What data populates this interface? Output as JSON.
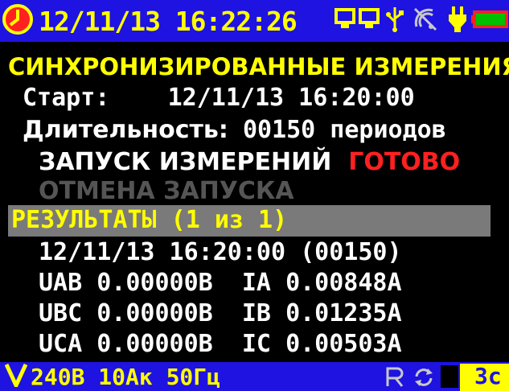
{
  "topbar": {
    "datetime": "12/11/13 16:22:26"
  },
  "screen": {
    "title": "СИНХРОНИЗИРОВАННЫЕ ИЗМЕРЕНИЯ",
    "start_label": "Старт:",
    "start_value": "12/11/13 16:20:00",
    "duration_label": "Длительность:",
    "duration_value": "00150 периодов",
    "launch_label": "ЗАПУСК ИЗМЕРЕНИЙ",
    "launch_status": "ГОТОВО",
    "cancel_label": "ОТМЕНА ЗАПУСКА",
    "results_label": "РЕЗУЛЬТАТЫ (1 из 1)",
    "result_header": "12/11/13 16:20:00 (00150)",
    "rows": [
      {
        "u_name": "UAB",
        "u_value": "0.00000В",
        "i_name": "IA",
        "i_value": "0.00848А"
      },
      {
        "u_name": "UBC",
        "u_value": "0.00000В",
        "i_name": "IB",
        "i_value": "0.01235А"
      },
      {
        "u_name": "UCA",
        "u_value": "0.00000В",
        "i_name": "IC",
        "i_value": "0.00503А"
      }
    ]
  },
  "bottombar": {
    "config": "240В 10Ак 50Гц",
    "timer": "3c"
  },
  "colors": {
    "bar_bg": "#1e13e0",
    "accent": "#ffff00",
    "status_ready": "#ff2020",
    "disabled": "#555555"
  }
}
